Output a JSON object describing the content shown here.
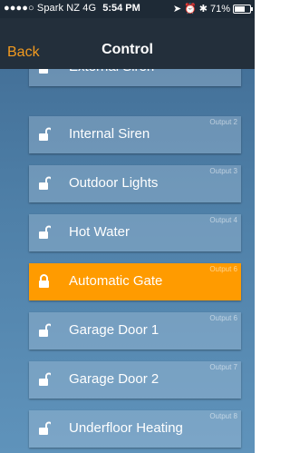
{
  "status_bar": {
    "carrier": "●●●●○ Spark NZ  4G",
    "time": "5:54 PM",
    "battery": "71%",
    "battery_level": 0.71
  },
  "nav": {
    "back_label": "Back",
    "title": "Control"
  },
  "outputs": [
    {
      "name": "External Siren",
      "output": "",
      "active": false
    },
    {
      "name": "Internal Siren",
      "output": "Output 2",
      "active": false
    },
    {
      "name": "Outdoor Lights",
      "output": "Output 3",
      "active": false
    },
    {
      "name": "Hot Water",
      "output": "Output 4",
      "active": false
    },
    {
      "name": "Automatic Gate",
      "output": "Output 6",
      "active": true
    },
    {
      "name": "Garage Door 1",
      "output": "Output 6",
      "active": false
    },
    {
      "name": "Garage Door 2",
      "output": "Output 7",
      "active": false
    },
    {
      "name": "Underfloor Heating",
      "output": "Output 8",
      "active": false
    }
  ],
  "colors": {
    "accent": "#f29a1f",
    "active_row": "#ff9b00",
    "navbar": "#232f3b"
  }
}
